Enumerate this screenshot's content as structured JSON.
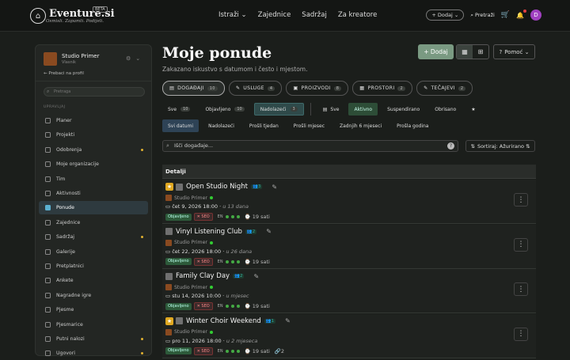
{
  "topbar": {
    "logo_text": "Eventure.si",
    "logo_sub": "Osmisli. Zapamti. Podijeli.",
    "beta": "BETA",
    "nav": [
      "Istraži",
      "Zajednice",
      "Sadržaj",
      "Za kreatore"
    ],
    "add_label": "+ Dodaj",
    "search_label": "Pretraži",
    "avatar": "D"
  },
  "sidebar": {
    "profile_name": "Studio Primer",
    "profile_role": "Vlasnik",
    "back_label": "Prebaci na profil",
    "search_placeholder": "Pretraga",
    "section_label": "UPRAVLJAJ",
    "items": [
      {
        "label": "Planer",
        "dot": false
      },
      {
        "label": "Projekti",
        "dot": false
      },
      {
        "label": "Odobrenja",
        "dot": true
      },
      {
        "label": "Moje organizacije",
        "dot": false
      },
      {
        "label": "Tim",
        "dot": false
      },
      {
        "label": "Aktivnosti",
        "dot": false
      },
      {
        "label": "Ponude",
        "dot": false,
        "active": true
      },
      {
        "label": "Zajednice",
        "dot": false
      },
      {
        "label": "Sadržaj",
        "dot": true
      },
      {
        "label": "Galerije",
        "dot": false
      },
      {
        "label": "Pretplatnici",
        "dot": false
      },
      {
        "label": "Ankete",
        "dot": false
      },
      {
        "label": "Nagradne igre",
        "dot": false
      },
      {
        "label": "Pjesme",
        "dot": false
      },
      {
        "label": "Pjesmarice",
        "dot": false
      },
      {
        "label": "Putni nalozi",
        "dot": true
      },
      {
        "label": "Ugovori",
        "dot": true
      }
    ]
  },
  "main": {
    "title": "Moje ponude",
    "subtitle": "Zakazano iskustvo s datumom i često i mjestom.",
    "add_label": "+ Dodaj",
    "help_label": "Pomoć",
    "categories": [
      {
        "label": "DOGAĐAJI",
        "count": "10"
      },
      {
        "label": "USLUGE",
        "count": "4"
      },
      {
        "label": "PROIZVODI",
        "count": "8"
      },
      {
        "label": "PROSTORI",
        "count": "2"
      },
      {
        "label": "TEČAJEVI",
        "count": "2"
      }
    ],
    "filters1": [
      {
        "label": "Sve",
        "count": "10"
      },
      {
        "label": "Objavljeno",
        "count": "10"
      },
      {
        "label": "Nadolazeći",
        "count": "3"
      }
    ],
    "filters2": [
      "Sve",
      "Aktivno",
      "Suspendirano",
      "Obrisano"
    ],
    "filters3": [
      "Svi datumi",
      "Nadolazeći",
      "Prošli tjedan",
      "Prošli mjesec",
      "Zadnjih 6 mjeseci",
      "Prošla godina"
    ],
    "search_placeholder": "Išči događaje...",
    "sort_label": "Sortiraj: Ažurirano",
    "table_header": "Detalji",
    "rows": [
      {
        "title": "Open Studio Night",
        "people": "3",
        "org": "Studio Primer",
        "date": "čet 9, 2026 18:00",
        "rel": "u 13 dana",
        "status": "Objavljeno",
        "seo": "SEO",
        "lang": "EN",
        "hours": "19 sati",
        "starred": true
      },
      {
        "title": "Vinyl Listening Club",
        "people": "2",
        "org": "Studio Primer",
        "date": "čet 22, 2026 18:00",
        "rel": "u 26 dana",
        "status": "Objavljeno",
        "seo": "SEO",
        "lang": "EN",
        "hours": "19 sati",
        "starred": false
      },
      {
        "title": "Family Clay Day",
        "people": "2",
        "org": "Studio Primer",
        "date": "stu 14, 2026 10:00",
        "rel": "u mjesec",
        "status": "Objavljeno",
        "seo": "SEO",
        "lang": "EN",
        "hours": "19 sati",
        "starred": false
      },
      {
        "title": "Winter Choir Weekend",
        "people": "1",
        "org": "Studio Primer",
        "date": "pro 11, 2026 18:00",
        "rel": "u 2 mjeseca",
        "status": "Objavljeno",
        "seo": "SEO",
        "lang": "EN",
        "hours": "19 sati",
        "extra": "2",
        "starred": true
      }
    ]
  }
}
